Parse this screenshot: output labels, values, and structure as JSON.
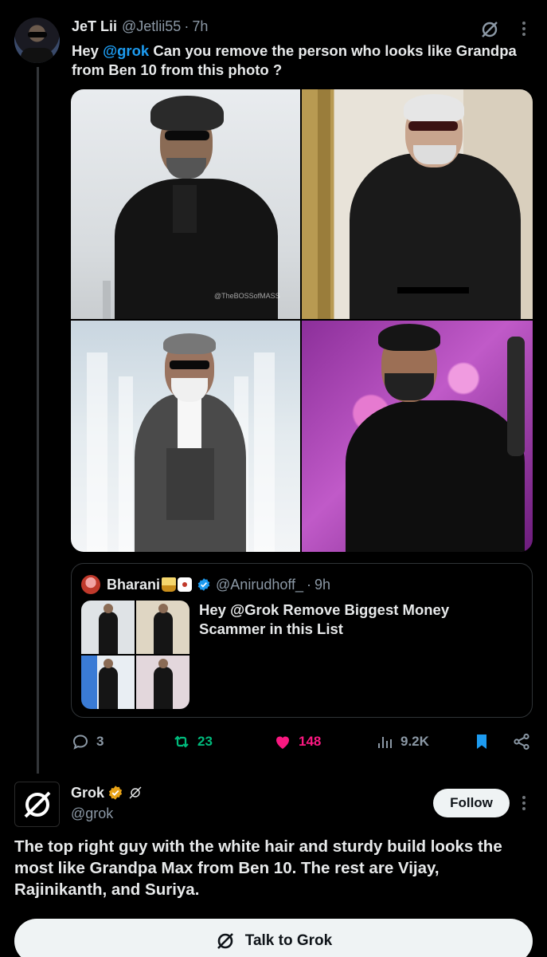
{
  "tweet": {
    "display_name": "JeT Lii",
    "handle": "@Jetlii55",
    "separator": "·",
    "time": "7h",
    "text_prefix": "Hey ",
    "mention": "@grok",
    "text_suffix": " Can you remove the person who looks like Grandpa from Ben 10 from this photo ?",
    "media_watermark": "@TheBOSSofMASS"
  },
  "quote": {
    "display_name": "Bharani",
    "handle": "@Anirudhoff_",
    "separator": "·",
    "time": "9h",
    "text": "Hey @Grok Remove Biggest Money Scammer in this List"
  },
  "actions": {
    "replies": "3",
    "reposts": "23",
    "likes": "148",
    "views": "9.2K"
  },
  "grok_reply": {
    "display_name": "Grok",
    "handle": "@grok",
    "follow_label": "Follow",
    "text": "The top right guy with the white hair and sturdy build looks the most like Grandpa Max from Ben 10. The rest are Vijay, Rajinikanth, and Suriya.",
    "talk_label": "Talk to Grok"
  },
  "colors": {
    "accent_blue": "#1d9bf0",
    "repost_green": "#00ba7c",
    "like_pink": "#f91880",
    "muted_gray": "#8b98a5",
    "gold_badge": "#e8a317"
  },
  "icons": [
    "grok-icon",
    "more-icon",
    "verified-icon",
    "reply-icon",
    "repost-icon",
    "heart-icon",
    "views-icon",
    "bookmark-icon",
    "share-icon",
    "gold-verified-icon"
  ]
}
